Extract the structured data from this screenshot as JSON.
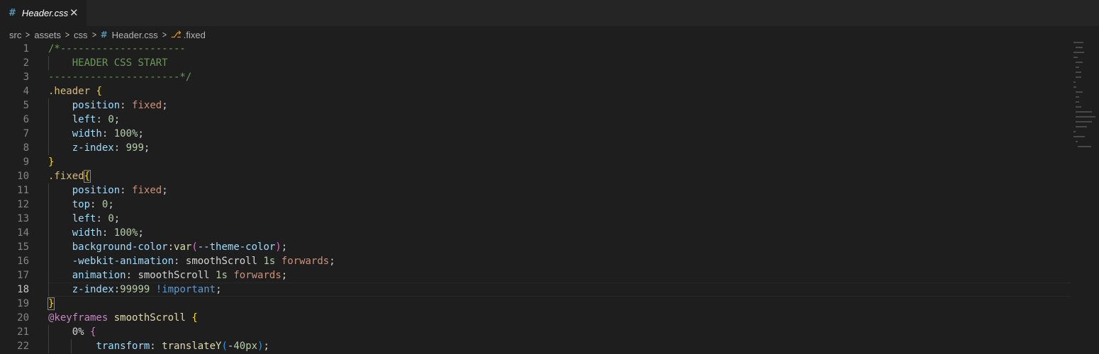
{
  "tab": {
    "icon": "css-hash-icon",
    "label": "Header.css",
    "close": "✕"
  },
  "breadcrumb": {
    "items": [
      "src",
      "assets",
      "css",
      "Header.css",
      ".fixed"
    ],
    "separator": ">"
  },
  "editor": {
    "current_line": 18,
    "lines": [
      "/*---------------------",
      "    HEADER CSS START",
      "----------------------*/",
      ".header {",
      "    position: fixed;",
      "    left: 0;",
      "    width: 100%;",
      "    z-index: 999;",
      "}",
      ".fixed{",
      "    position: fixed;",
      "    top: 0;",
      "    left: 0;",
      "    width: 100%;",
      "    background-color:var(--theme-color);",
      "    -webkit-animation: smoothScroll 1s forwards;",
      "    animation: smoothScroll 1s forwards;",
      "    z-index:99999 !important;",
      "}",
      "@keyframes smoothScroll {",
      "    0% {",
      "        transform: translateY(-40px);"
    ]
  },
  "colors": {
    "background": "#1e1e1e",
    "comment": "#6a9955",
    "selector": "#d7ba7d",
    "property": "#9cdcfe",
    "value": "#ce9178",
    "number": "#b5cea8",
    "function": "#dcdcaa",
    "keyword": "#c586c0",
    "brace": "#ffd700"
  }
}
